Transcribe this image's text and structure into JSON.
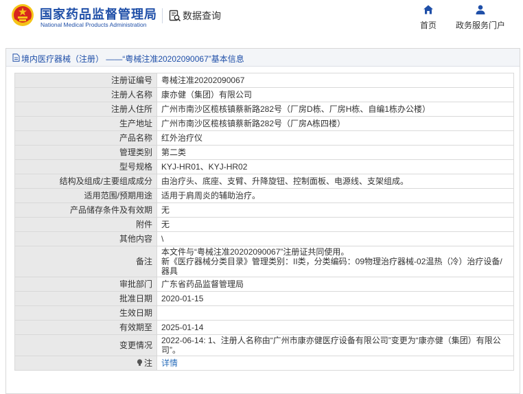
{
  "header": {
    "brand_cn": "国家药品监督管理局",
    "brand_en": "National Medical Products Administration",
    "query_label": "数据查询",
    "nav": [
      {
        "label": "首页",
        "icon": "home-icon"
      },
      {
        "label": "政务服务门户",
        "icon": "user-icon"
      }
    ]
  },
  "panel": {
    "title": "境内医疗器械（注册） ——“粤械注准20202090067”基本信息"
  },
  "rows": [
    {
      "label": "注册证编号",
      "value": "粤械注准20202090067"
    },
    {
      "label": "注册人名称",
      "value": "康亦健（集团）有限公司"
    },
    {
      "label": "注册人住所",
      "value": "广州市南沙区榄核镇蔡新路282号（厂房D栋、厂房H栋、自编1栋办公楼）"
    },
    {
      "label": "生产地址",
      "value": "广州市南沙区榄核镇蔡新路282号（厂房A栋四楼）"
    },
    {
      "label": "产品名称",
      "value": "红外治疗仪"
    },
    {
      "label": "管理类别",
      "value": "第二类"
    },
    {
      "label": "型号规格",
      "value": "KYJ-HR01、KYJ-HR02"
    },
    {
      "label": "结构及组成/主要组成成分",
      "value": "由治疗头、底座、支臂、升降旋钮、控制面板、电源线、支架组成。"
    },
    {
      "label": "适用范围/预期用途",
      "value": "适用于肩周炎的辅助治疗。"
    },
    {
      "label": "产品储存条件及有效期",
      "value": "无"
    },
    {
      "label": "附件",
      "value": "无"
    },
    {
      "label": "其他内容",
      "value": "\\"
    },
    {
      "label": "备注",
      "value": "本文件与“粤械注准20202090067”注册证共同使用。\n新《医疗器械分类目录》管理类别：II类，分类编码：09物理治疗器械-02温热（冷）治疗设备/器具"
    },
    {
      "label": "审批部门",
      "value": "广东省药品监督管理局"
    },
    {
      "label": "批准日期",
      "value": "2020-01-15"
    },
    {
      "label": "生效日期",
      "value": ""
    },
    {
      "label": "有效期至",
      "value": "2025-01-14"
    },
    {
      "label": "变更情况",
      "value": "2022-06-14: 1、注册人名称由“广州市康亦健医疗设备有限公司”变更为“康亦健（集团）有限公司”。"
    }
  ],
  "note": {
    "label": "注",
    "link_text": "详情"
  },
  "colors": {
    "brand_blue": "#1f4fa8",
    "label_bg": "#e9e9e9",
    "link": "#2a6ebb",
    "emblem_red": "#d7261e",
    "emblem_gold": "#f5c518"
  }
}
